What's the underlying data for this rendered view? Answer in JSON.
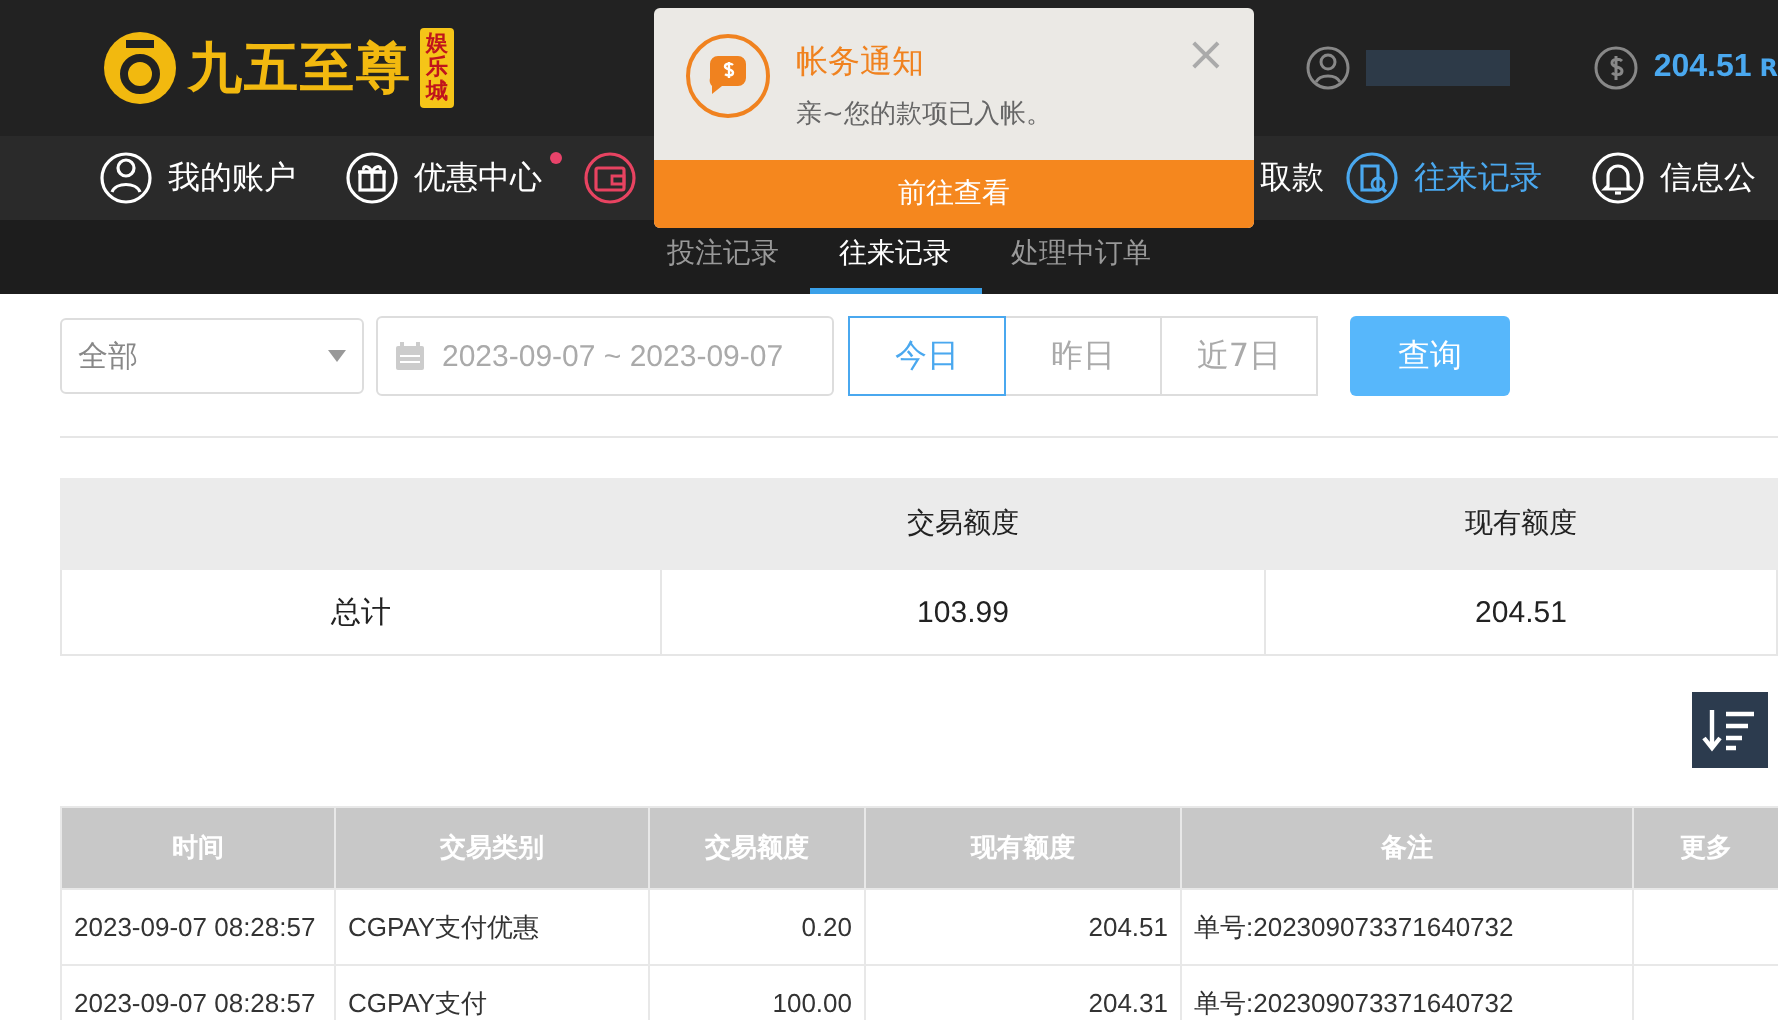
{
  "header": {
    "logo": {
      "name": "九五至尊",
      "badge": "娱乐城"
    },
    "balance": "204.51",
    "currency": "R"
  },
  "nav": [
    {
      "kind": "full",
      "label": "我的账户",
      "selected": false,
      "dot": false,
      "accent": false
    },
    {
      "kind": "full",
      "label": "优惠中心",
      "selected": false,
      "dot": true,
      "accent": false
    },
    {
      "kind": "icon-only",
      "selected": false,
      "dot": false,
      "accent": true
    },
    {
      "kind": "text-only",
      "label": "取款",
      "selected": false,
      "dot": false,
      "accent": false
    },
    {
      "kind": "full",
      "label": "往来记录",
      "selected": true,
      "dot": false,
      "accent": false
    },
    {
      "kind": "full",
      "label": "信息公",
      "selected": false,
      "dot": false,
      "accent": false
    }
  ],
  "subtabs": [
    {
      "label": "投注记录",
      "selected": false
    },
    {
      "label": "往来记录",
      "selected": true
    },
    {
      "label": "处理中订单",
      "selected": false
    }
  ],
  "notification": {
    "title": "帐务通知",
    "message": "亲~您的款项已入帐。",
    "close": "×",
    "action": "前往查看"
  },
  "filters": {
    "type": {
      "value": "全部"
    },
    "date_range": {
      "value": "2023-09-07 ~ 2023-09-07"
    },
    "ranges": [
      {
        "label": "今日",
        "selected": true
      },
      {
        "label": "昨日",
        "selected": false
      },
      {
        "label": "近7日",
        "selected": false
      }
    ],
    "search_button": "查询"
  },
  "summary": {
    "columns": [
      "交易额度",
      "现有额度"
    ],
    "rows": [
      {
        "label": "总计",
        "values": [
          "103.99",
          "204.51"
        ]
      }
    ]
  },
  "table": {
    "columns": [
      "时间",
      "交易类别",
      "交易额度",
      "现有额度",
      "备注",
      "更多"
    ],
    "rows": [
      [
        "2023-09-07 08:28:57",
        "CGPAY支付优惠",
        "0.20",
        "204.51",
        "单号:202309073371640732"
      ],
      [
        "2023-09-07 08:28:57",
        "CGPAY支付",
        "100.00",
        "204.31",
        "单号:202309073371640732"
      ]
    ]
  }
}
